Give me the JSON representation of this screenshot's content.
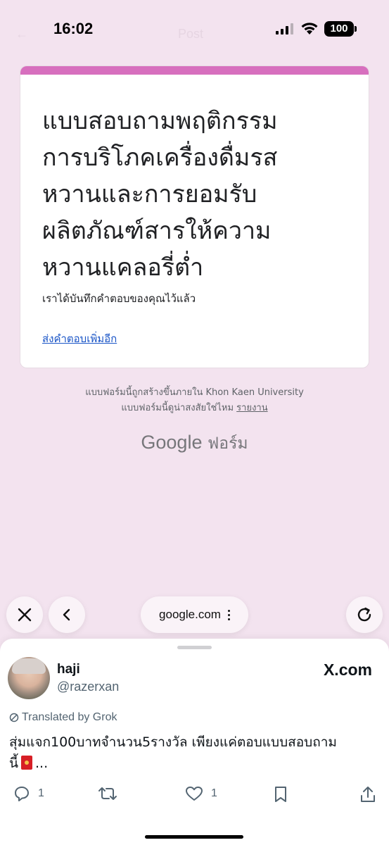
{
  "status_bar": {
    "time": "16:02",
    "battery": "100",
    "faded_title": "Post"
  },
  "form": {
    "accent_color": "#d76fbe",
    "title_lines": [
      "แบบสอบถามพฤติกรรม",
      "การบริโภคเครื่องดื่มรส",
      "หวานและการยอมรับ",
      "ผลิตภัณฑ์สารให้ความ",
      "หวานแคลอรี่ต่ำ"
    ],
    "confirmation": "เราได้บันทึกคำตอบของคุณไว้แล้ว",
    "submit_another_link": "ส่งคำตอบเพิ่มอีก",
    "footer_created": "แบบฟอร์มนี้ถูกสร้างขึ้นภายใน Khon Kaen University",
    "footer_suspicious": "แบบฟอร์มนี้ดูน่าสงสัยใช่ไหม",
    "footer_report_link": "รายงาน",
    "branding_google": "Google",
    "branding_forms": "ฟอร์ม"
  },
  "browser": {
    "close_icon": "close-icon",
    "back_icon": "chevron-left-icon",
    "url": "google.com",
    "reload_icon": "reload-icon"
  },
  "tweet": {
    "name": "haji",
    "handle": "@razerxan",
    "site": "X.com",
    "translated_label": "Translated by Grok",
    "text": "สุ่มแจก100บาทจำนวน5รางวัล เพียงแค่ตอบแบบสอบถาม",
    "text_line2_before": "นี้",
    "text_line2_after": "...",
    "reply_count": "1",
    "like_count": "1"
  }
}
